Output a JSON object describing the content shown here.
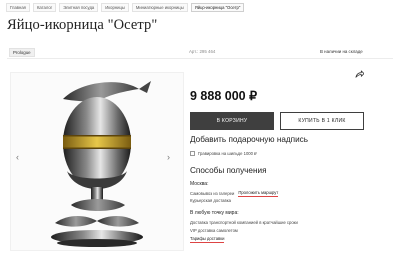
{
  "breadcrumbs": [
    "Главная",
    "Каталог",
    "Элитная посуда",
    "Икорницы",
    "Миниатюрные икорницы",
    "Яйцо-икорница \"Осетр\""
  ],
  "page_title": "Яйцо-икорница \"Осетр\"",
  "brand_badge": "Prologue",
  "sku": "Арт.: 295 464",
  "stock_status": "В наличии на складе",
  "price": "9 888 000 ₽",
  "buttons": {
    "add_to_cart": "В КОРЗИНУ",
    "buy_one_click": "КУПИТЬ В 1 КЛИК"
  },
  "gift": {
    "title": "Добавить подарочную надпись",
    "engraving_label": "Гравировка на шильде 1000 ₽"
  },
  "delivery": {
    "title": "Способы получения",
    "moscow_title": "Москва:",
    "pickup": "Самовывоз из галереи",
    "route_link": "Проложить маршрут",
    "courier": "Курьерская доставка",
    "world_title": "В любую точку мира:",
    "transport": "Доставка транспортной компанией в кратчайшие сроки",
    "vip": "VIP доставка самолетом",
    "tariffs": "Тарифы доставки"
  },
  "gallery": {
    "prev": "‹",
    "next": "›"
  },
  "icons": {
    "share": "share-icon",
    "prev": "chevron-left-icon",
    "next": "chevron-right-icon"
  },
  "colors": {
    "accent": "#3f3f3f",
    "link_underline": "#dd4444",
    "gold": "#c9a227"
  }
}
